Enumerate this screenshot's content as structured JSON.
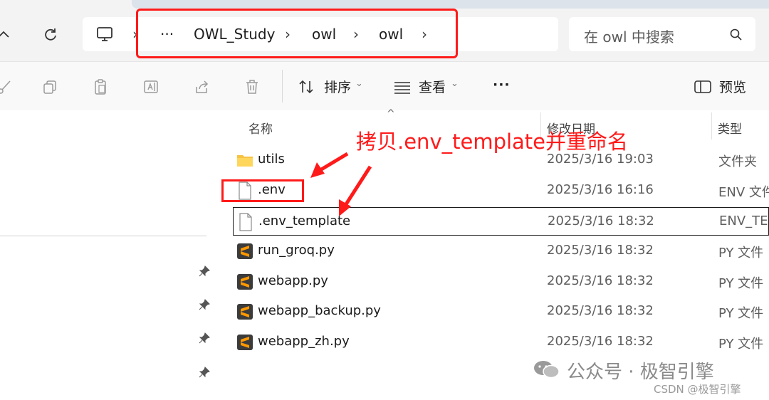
{
  "breadcrumb": {
    "more": "···",
    "items": [
      "OWL_Study",
      "owl",
      "owl"
    ],
    "separator": "›"
  },
  "search": {
    "placeholder": "在 owl 中搜索"
  },
  "toolbar": {
    "sort_label": "排序",
    "view_label": "查看",
    "more_label": "···",
    "preview_label": "预览"
  },
  "columns": {
    "name": "名称",
    "modified": "修改日期",
    "type": "类型"
  },
  "files": [
    {
      "name": "utils",
      "modified": "2025/3/16 19:03",
      "type": "文件夹",
      "icon": "folder-icon"
    },
    {
      "name": ".env",
      "modified": "2025/3/16 16:16",
      "type": "ENV 文件",
      "icon": "file-icon"
    },
    {
      "name": ".env_template",
      "modified": "2025/3/16 18:32",
      "type": "ENV_TEM",
      "icon": "file-icon"
    },
    {
      "name": "run_groq.py",
      "modified": "2025/3/16 18:32",
      "type": "PY 文件",
      "icon": "sublime-icon"
    },
    {
      "name": "webapp.py",
      "modified": "2025/3/16 18:32",
      "type": "PY 文件",
      "icon": "sublime-icon"
    },
    {
      "name": "webapp_backup.py",
      "modified": "2025/3/16 18:32",
      "type": "PY 文件",
      "icon": "sublime-icon"
    },
    {
      "name": "webapp_zh.py",
      "modified": "2025/3/16 18:32",
      "type": "PY 文件",
      "icon": "sublime-icon"
    }
  ],
  "annotation": "拷贝.env_template并重命名",
  "watermark": {
    "text": "公众号 · 极智引擎",
    "csdn": "CSDN @极智引擎"
  },
  "colors": {
    "highlight": "#ff1a1a",
    "sublime_orange": "#ff9800",
    "sublime_bg": "#3b3b3b",
    "folder": "#f6c343"
  }
}
